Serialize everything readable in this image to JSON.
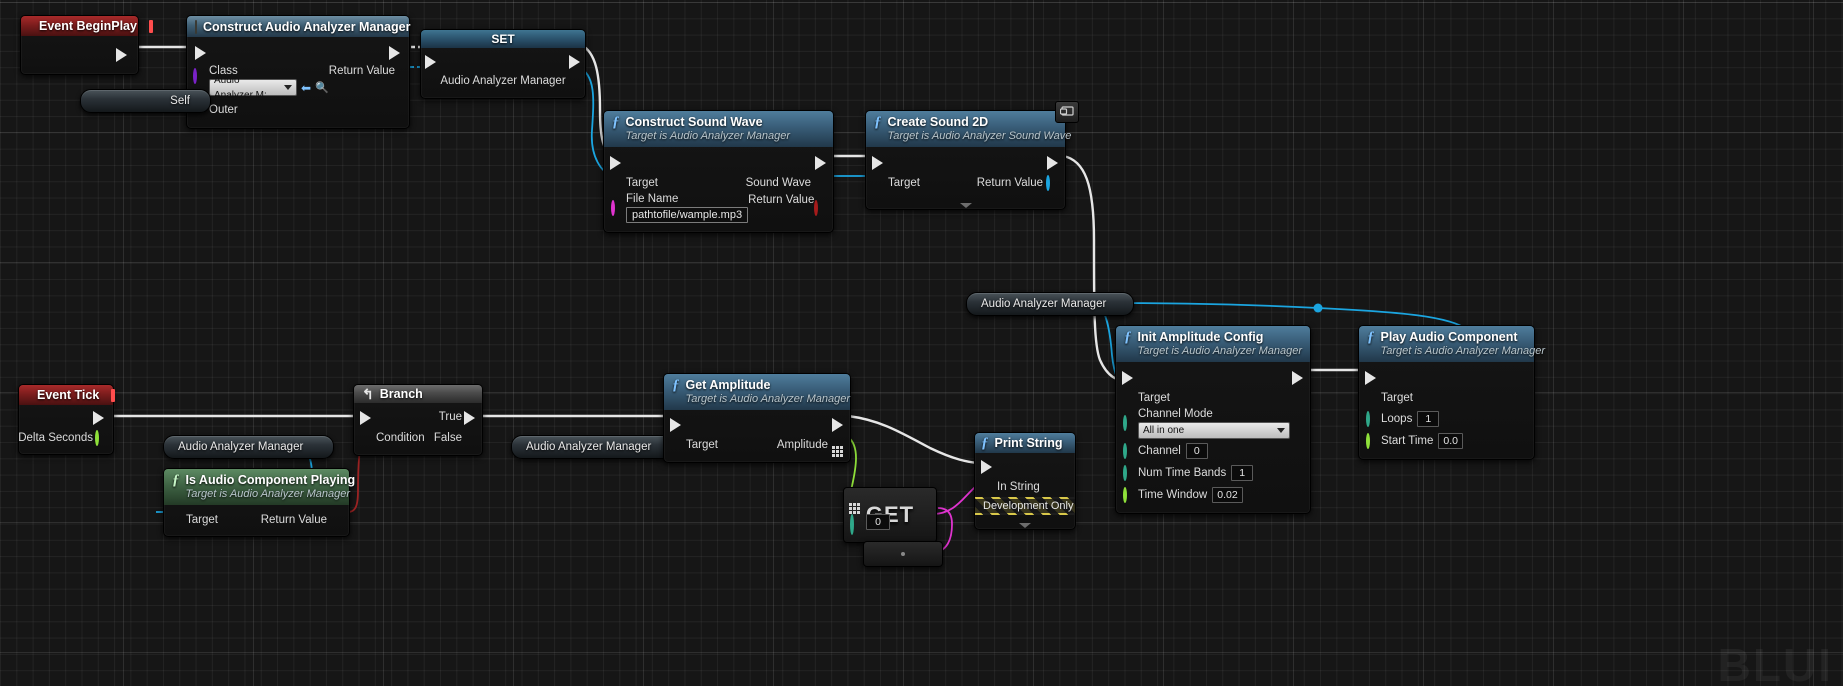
{
  "graph": {
    "watermark": "BLUI",
    "nodes": {
      "event_begin_play": {
        "title": "Event BeginPlay"
      },
      "construct_manager": {
        "title": "Construct Audio Analyzer Manager",
        "class_label": "Class",
        "class_value": "Audio Analyzer M:",
        "outer_label": "Outer",
        "return_label": "Return Value"
      },
      "set_node": {
        "title": "SET",
        "var_label": "Audio Analyzer Manager"
      },
      "self_pill": {
        "label": "Self"
      },
      "construct_sound_wave": {
        "title": "Construct Sound Wave",
        "subtitle": "Target is Audio Analyzer Manager",
        "target_label": "Target",
        "file_name_label": "File Name",
        "file_name_value": "pathtofile/wample.mp3",
        "sound_wave_label": "Sound Wave",
        "return_label": "Return Value"
      },
      "create_sound_2d": {
        "title": "Create Sound 2D",
        "subtitle": "Target is Audio Analyzer Sound Wave",
        "target_label": "Target",
        "return_label": "Return Value"
      },
      "manager_pill_top": {
        "label": "Audio Analyzer Manager"
      },
      "event_tick": {
        "title": "Event Tick",
        "delta_label": "Delta Seconds"
      },
      "manager_pill_branch": {
        "label": "Audio Analyzer Manager"
      },
      "is_playing": {
        "title": "Is Audio Component Playing",
        "subtitle": "Target is Audio Analyzer Manager",
        "target_label": "Target",
        "return_label": "Return Value"
      },
      "branch": {
        "title": "Branch",
        "condition_label": "Condition",
        "true_label": "True",
        "false_label": "False"
      },
      "manager_pill_amp": {
        "label": "Audio Analyzer Manager"
      },
      "get_amplitude": {
        "title": "Get Amplitude",
        "subtitle": "Target is Audio Analyzer Manager",
        "target_label": "Target",
        "amplitude_label": "Amplitude"
      },
      "get_array": {
        "title": "GET",
        "index_value": "0"
      },
      "print_string": {
        "title": "Print String",
        "in_string_label": "In String",
        "dev_only_label": "Development Only"
      },
      "init_amplitude_config": {
        "title": "Init Amplitude Config",
        "subtitle": "Target is Audio Analyzer Manager",
        "target_label": "Target",
        "channel_mode_label": "Channel Mode",
        "channel_mode_value": "All in one",
        "channel_label": "Channel",
        "channel_value": "0",
        "num_time_bands_label": "Num Time Bands",
        "num_time_bands_value": "1",
        "time_window_label": "Time Window",
        "time_window_value": "0.02"
      },
      "play_audio_component": {
        "title": "Play Audio Component",
        "subtitle": "Target is Audio Analyzer Manager",
        "target_label": "Target",
        "loops_label": "Loops",
        "loops_value": "1",
        "start_time_label": "Start Time",
        "start_time_value": "0.0"
      }
    },
    "colors": {
      "exec": "#e6e6e6",
      "object_pin": "#1ba5e0",
      "string_pin": "#e033cf",
      "bool_pin": "#9c2323",
      "float_pin": "#8fe03a",
      "int_pin": "#27d6a5",
      "class_pin": "#7a22c8",
      "struct_pin": "#0a4f8c",
      "wildcard_pin": "#b0b0b0"
    }
  }
}
